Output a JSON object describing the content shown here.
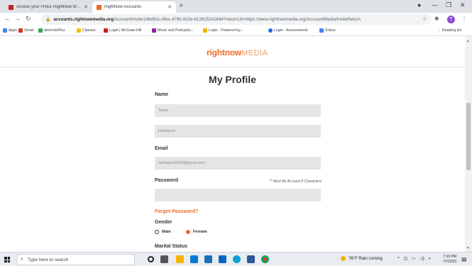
{
  "browser": {
    "tabs": [
      {
        "title": "Access your FREE RightNow Med",
        "active": false,
        "favicon_color": "#c5221f"
      },
      {
        "title": "RightNow Accounts",
        "active": true,
        "favicon_color": "#ef6b24"
      }
    ],
    "new_tab_label": "+",
    "url_host": "accounts.rightnowmedia.org",
    "url_path": "/Account/Invite/14bd91c-6fec-479b-910e-b12615141644?returnUrl=https://www.rightnowmedia.org/Account/Media/InviteReturn",
    "bookmarks": [
      {
        "label": "Apps",
        "color": "#4285f4"
      },
      {
        "label": "Gmail",
        "color": "#d93025"
      },
      {
        "label": "almondsPlus",
        "color": "#34a853"
      },
      {
        "label": "Classes",
        "color": "#fbbc04"
      },
      {
        "label": "Login | McGraw-Hill",
        "color": "#c5221f"
      },
      {
        "label": "Music and Podcasts...",
        "color": "#8e24aa"
      },
      {
        "label": "Login - Powered by...",
        "color": "#5f6368"
      },
      {
        "label": "Login - Assessments",
        "color": "#1a73e8"
      },
      {
        "label": "Sobus",
        "color": "#5f6368"
      }
    ],
    "reading_list": "Reading list",
    "profile_initial": "T"
  },
  "page": {
    "logo_primary": "rightnow",
    "logo_secondary": "MEDIA",
    "title": "My Profile",
    "name_label": "Name",
    "first_name_value": "Tarah",
    "last_name_value": "Holmgren",
    "email_label": "Email",
    "email_value": "holmgren2002@gmail.com",
    "password_label": "Password",
    "password_hint": "** Must Be At Least 8 Characters",
    "password_value": "",
    "forgot_password": "Forgot Password?",
    "gender_label": "Gender",
    "gender_options": [
      {
        "label": "Male",
        "selected": false
      },
      {
        "label": "Female",
        "selected": true
      }
    ],
    "marital_label": "Marital Status"
  },
  "taskbar": {
    "search_placeholder": "Type here to search",
    "weather": "76°F Rain coming",
    "time": "7:10 PM",
    "date": "7/7/2021"
  }
}
